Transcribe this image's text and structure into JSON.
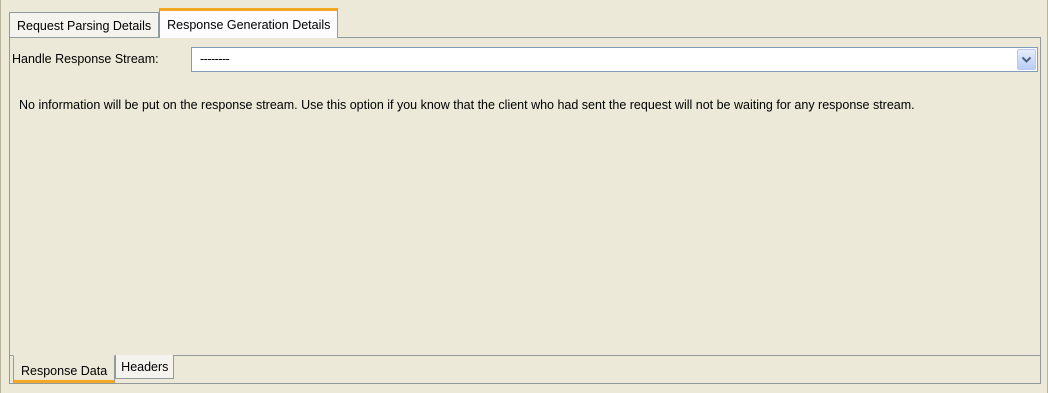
{
  "top_tabs": [
    {
      "label": "Request Parsing Details",
      "selected": false
    },
    {
      "label": "Response Generation Details",
      "selected": true
    }
  ],
  "response_stream": {
    "label": "Handle Response Stream:",
    "value": "--------"
  },
  "description": "No information will be put on the response stream. Use this option if you know that the client who had sent the request will not be waiting for any response stream.",
  "bottom_tabs": [
    {
      "label": "Response Data",
      "selected": true
    },
    {
      "label": "Headers",
      "selected": false
    }
  ],
  "colors": {
    "accent": "#f5a823",
    "background": "#ece9d8",
    "border": "#919b9c"
  },
  "icons": {
    "dropdown": "chevron-down-icon"
  }
}
